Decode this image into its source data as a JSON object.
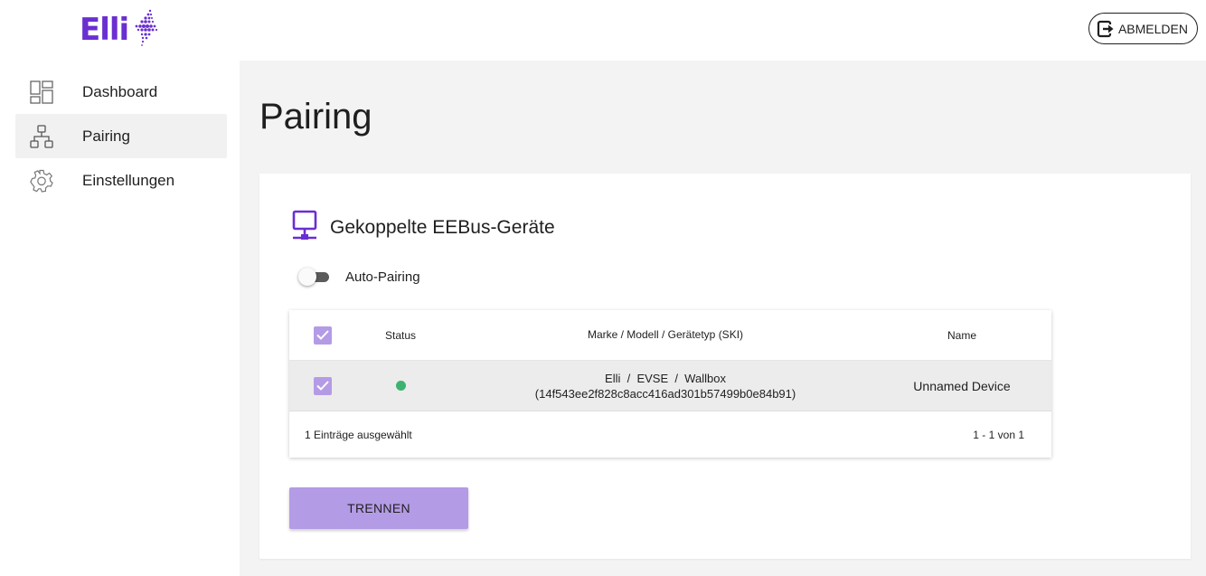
{
  "brand": {
    "logo_text": "Elli",
    "logo_icon": "elli-spark-logo",
    "accent_color": "#6a2fd1"
  },
  "header": {
    "logout_label": "ABMELDEN",
    "logout_icon": "logout-icon"
  },
  "sidebar": {
    "items": [
      {
        "label": "Dashboard",
        "icon": "dashboard-grid-icon",
        "active": false
      },
      {
        "label": "Pairing",
        "icon": "network-icon",
        "active": true
      },
      {
        "label": "Einstellungen",
        "icon": "gear-icon",
        "active": false
      }
    ]
  },
  "page": {
    "title": "Pairing"
  },
  "card": {
    "title": "Gekoppelte EEBus-Geräte",
    "title_icon": "computer-network-icon",
    "auto_pairing": {
      "label": "Auto-Pairing",
      "enabled": false
    },
    "table": {
      "columns": [
        "Status",
        "Marke / Modell / Gerätetyp (SKI)",
        "Name"
      ],
      "header_checked": true,
      "rows": [
        {
          "checked": true,
          "status": "online",
          "status_color": "#3cb371",
          "model_line1": "Elli  /  EVSE  /  Wallbox",
          "model_line2": "(14f543ee2f828c8acc416ad301b57499b0e84b91)",
          "name": "Unnamed Device"
        }
      ],
      "footer_selected": "1 Einträge ausgewählt",
      "footer_pagination": "1 - 1 von 1"
    },
    "disconnect_button": "TRENNEN",
    "button_color": "#b49be6"
  }
}
